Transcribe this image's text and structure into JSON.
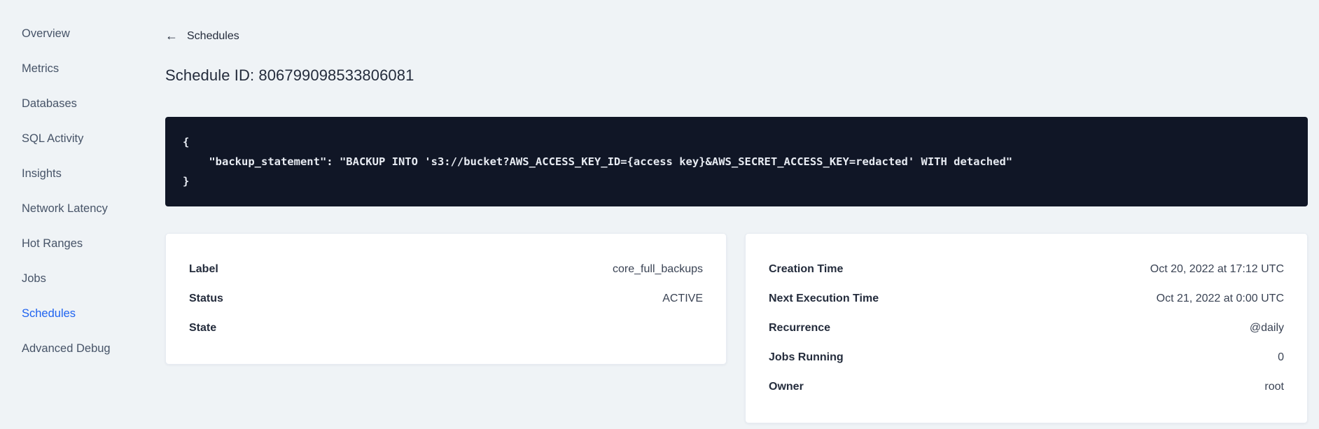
{
  "sidebar": {
    "items": [
      {
        "label": "Overview",
        "active": false
      },
      {
        "label": "Metrics",
        "active": false
      },
      {
        "label": "Databases",
        "active": false
      },
      {
        "label": "SQL Activity",
        "active": false
      },
      {
        "label": "Insights",
        "active": false
      },
      {
        "label": "Network Latency",
        "active": false
      },
      {
        "label": "Hot Ranges",
        "active": false
      },
      {
        "label": "Jobs",
        "active": false
      },
      {
        "label": "Schedules",
        "active": true
      },
      {
        "label": "Advanced Debug",
        "active": false
      }
    ]
  },
  "header": {
    "back_arrow": "←",
    "back_label": "Schedules",
    "title": "Schedule ID: 806799098533806081"
  },
  "code_block": {
    "content": "{\n    \"backup_statement\": \"BACKUP INTO 's3://bucket?AWS_ACCESS_KEY_ID={access key}&AWS_SECRET_ACCESS_KEY=redacted' WITH detached\"\n}"
  },
  "cards": {
    "schedule": {
      "rows": [
        {
          "label": "Label",
          "value": "core_full_backups"
        },
        {
          "label": "Status",
          "value": "ACTIVE"
        },
        {
          "label": "State",
          "value": ""
        }
      ]
    },
    "execution": {
      "rows": [
        {
          "label": "Creation Time",
          "value": "Oct 20, 2022 at 17:12 UTC"
        },
        {
          "label": "Next Execution Time",
          "value": "Oct 21, 2022 at 0:00 UTC"
        },
        {
          "label": "Recurrence",
          "value": "@daily"
        },
        {
          "label": "Jobs Running",
          "value": "0"
        },
        {
          "label": "Owner",
          "value": "root"
        }
      ]
    }
  },
  "colors": {
    "accent_blue": "#1f63f0",
    "code_background": "#101626",
    "page_background": "#eff3f6"
  }
}
